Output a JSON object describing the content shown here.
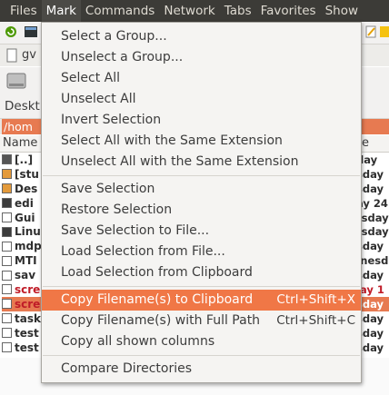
{
  "menubar": {
    "items": [
      "Files",
      "Mark",
      "Commands",
      "Network",
      "Tabs",
      "Favorites",
      "Show"
    ],
    "active": "Mark"
  },
  "background": {
    "path_field": "gv",
    "tab_label": "Deskt",
    "current_path": "/hom",
    "column_name": "Name",
    "column_right": "e",
    "files": [
      {
        "name": "[..]",
        "style": "normal",
        "icon": "up"
      },
      {
        "name": "[stu",
        "style": "normal",
        "icon": "folder"
      },
      {
        "name": "Des",
        "style": "normal",
        "icon": "folder"
      },
      {
        "name": "edi",
        "style": "normal",
        "icon": "file-dark"
      },
      {
        "name": "Gui",
        "style": "normal",
        "icon": "file"
      },
      {
        "name": "Linu",
        "style": "normal",
        "icon": "file-dark"
      },
      {
        "name": "mdp",
        "style": "normal",
        "icon": "file"
      },
      {
        "name": "MTI",
        "style": "normal",
        "icon": "file"
      },
      {
        "name": "sav",
        "style": "normal",
        "icon": "file"
      },
      {
        "name": "scre",
        "style": "red",
        "icon": "file"
      },
      {
        "name": "scre",
        "style": "selected",
        "icon": "file"
      },
      {
        "name": "task",
        "style": "normal",
        "icon": "file"
      },
      {
        "name": "test",
        "style": "normal",
        "icon": "file"
      },
      {
        "name": "test",
        "style": "normal",
        "icon": "file"
      }
    ],
    "right_column": [
      {
        "text": "day",
        "style": "normal"
      },
      {
        "text": "sday",
        "style": "normal"
      },
      {
        "text": "sday",
        "style": "normal"
      },
      {
        "text": "ay 24",
        "style": "normal"
      },
      {
        "text": "rsday",
        "style": "normal"
      },
      {
        "text": "rsday",
        "style": "normal"
      },
      {
        "text": "sday",
        "style": "normal"
      },
      {
        "text": "Inesd",
        "style": "normal"
      },
      {
        "text": "sday",
        "style": "normal"
      },
      {
        "text": "lay 1",
        "style": "red"
      },
      {
        "text": "sday",
        "style": "selected"
      },
      {
        "text": "sday",
        "style": "normal"
      },
      {
        "text": "sday",
        "style": "normal"
      },
      {
        "text": "sday",
        "style": "normal"
      }
    ]
  },
  "mark_menu": {
    "items": [
      {
        "label": "Select a Group...",
        "accel": "",
        "highlighted": false,
        "separator_after": false
      },
      {
        "label": "Unselect a Group...",
        "accel": "",
        "highlighted": false,
        "separator_after": false
      },
      {
        "label": "Select All",
        "accel": "",
        "highlighted": false,
        "separator_after": false
      },
      {
        "label": "Unselect All",
        "accel": "",
        "highlighted": false,
        "separator_after": false
      },
      {
        "label": "Invert Selection",
        "accel": "",
        "highlighted": false,
        "separator_after": false
      },
      {
        "label": "Select All with the Same Extension",
        "accel": "",
        "highlighted": false,
        "separator_after": false
      },
      {
        "label": "Unselect All with the Same Extension",
        "accel": "",
        "highlighted": false,
        "separator_after": true
      },
      {
        "label": "Save Selection",
        "accel": "",
        "highlighted": false,
        "separator_after": false
      },
      {
        "label": "Restore Selection",
        "accel": "",
        "highlighted": false,
        "separator_after": false
      },
      {
        "label": "Save Selection to File...",
        "accel": "",
        "highlighted": false,
        "separator_after": false
      },
      {
        "label": "Load Selection from File...",
        "accel": "",
        "highlighted": false,
        "separator_after": false
      },
      {
        "label": "Load Selection from Clipboard",
        "accel": "",
        "highlighted": false,
        "separator_after": true
      },
      {
        "label": "Copy Filename(s) to Clipboard",
        "accel": "Ctrl+Shift+X",
        "highlighted": true,
        "separator_after": false
      },
      {
        "label": "Copy Filename(s) with Full Path",
        "accel": "Ctrl+Shift+C",
        "highlighted": false,
        "separator_after": false
      },
      {
        "label": "Copy all shown columns",
        "accel": "",
        "highlighted": false,
        "separator_after": true
      },
      {
        "label": "Compare Directories",
        "accel": "",
        "highlighted": false,
        "separator_after": false
      }
    ]
  },
  "colors": {
    "menubar_bg": "#3c3b37",
    "menubar_fg": "#dfdbd2",
    "highlight": "#f07746",
    "path_bg": "#e77a51",
    "marked_text": "#c01c28"
  }
}
